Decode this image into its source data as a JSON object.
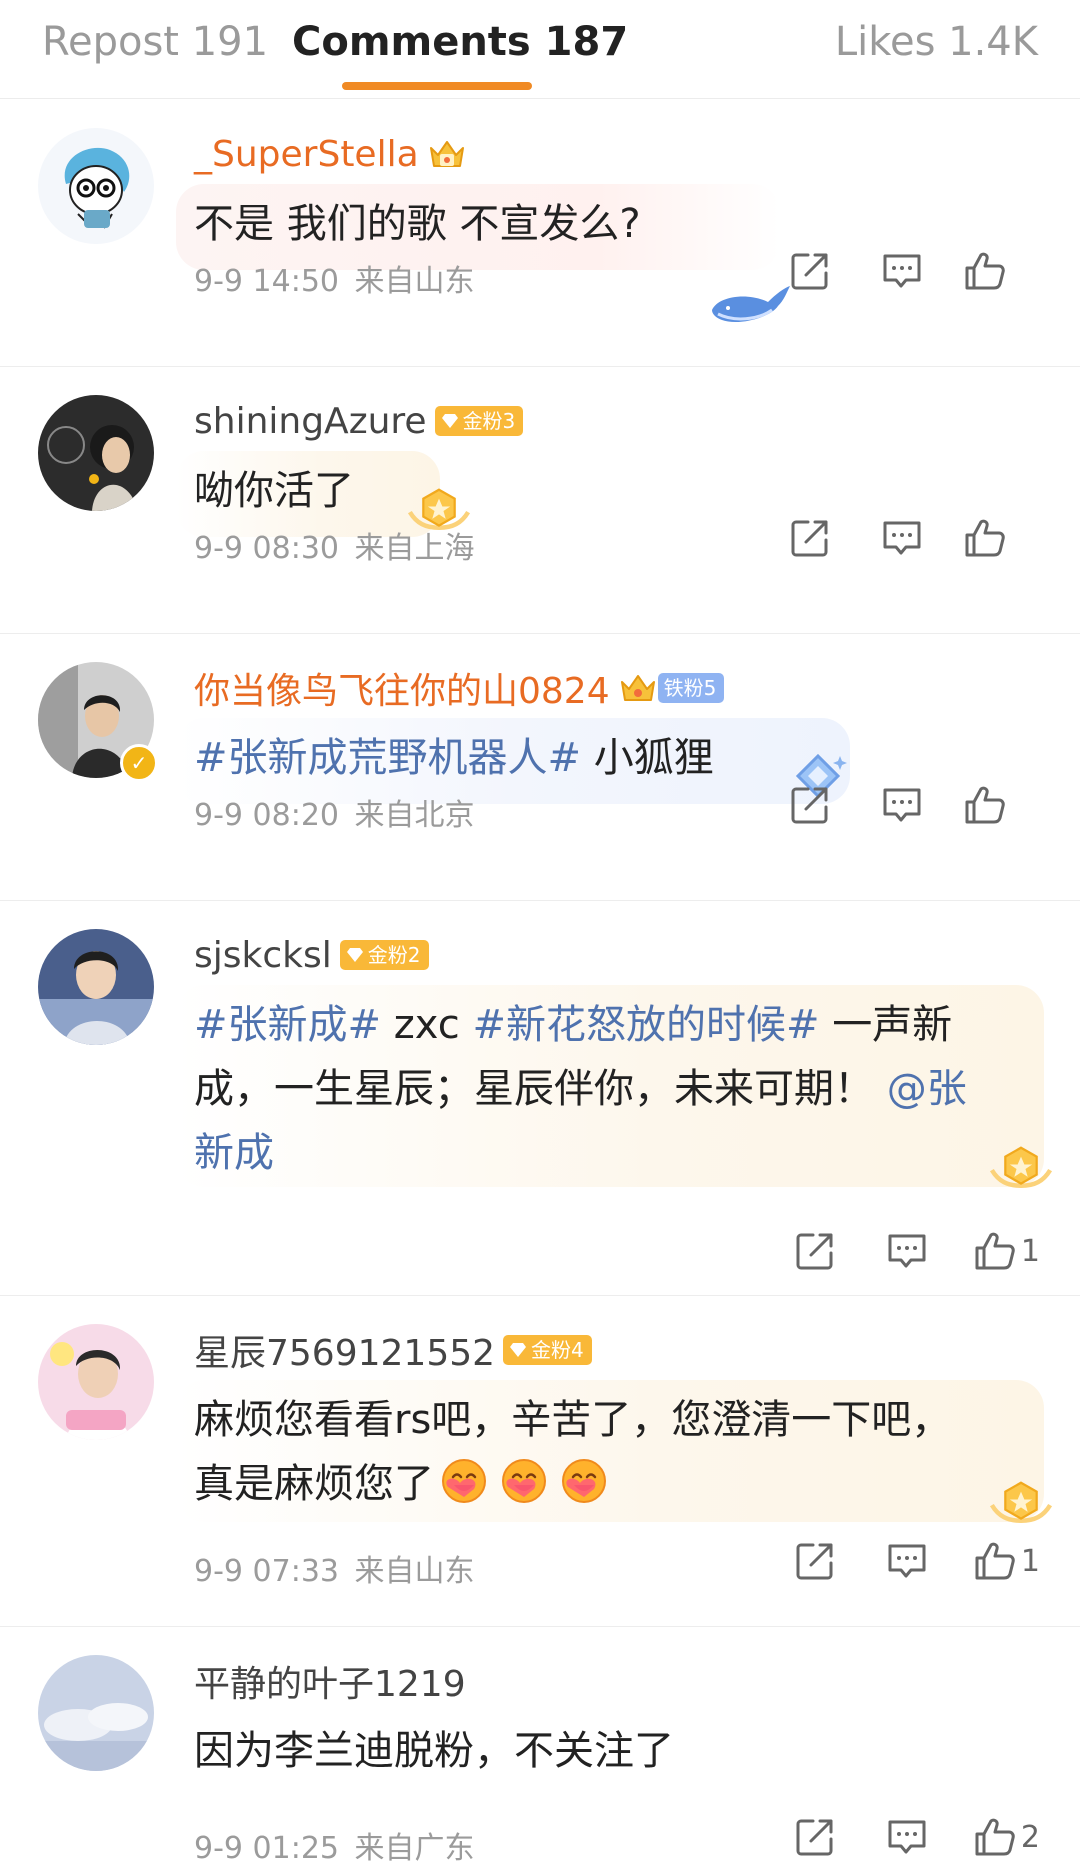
{
  "tabs": {
    "repost": "Repost 191",
    "comments": "Comments 187",
    "likes": "Likes 1.4K"
  },
  "colors": {
    "accent": "#f08a24",
    "hashtag": "#4f72ae",
    "vip_name": "#e86b23",
    "gold_badge": "#f9b838"
  },
  "comments": [
    {
      "username": "_SuperStella",
      "name_style": "vip",
      "badge": null,
      "text": "不是 我们的歌 不宣发么?",
      "time": "9-9 14:50",
      "location": "来自山东",
      "likes": "",
      "icons": [
        "crown-icon",
        "whale-icon"
      ]
    },
    {
      "username": "shiningAzure",
      "badge": "金粉3",
      "text": "呦你活了",
      "time": "9-9 08:30",
      "location": "来自上海",
      "likes": ""
    },
    {
      "username": "你当像鸟飞往你的山0824",
      "name_style": "vip",
      "badge": "铁粉5",
      "hashtag": "#张新成荒野机器人#",
      "text": "小狐狸",
      "time": "9-9 08:20",
      "location": "来自北京",
      "likes": "",
      "verified": true
    },
    {
      "username": "sjskcksl",
      "badge": "金粉2",
      "hashtag1": "#张新成#",
      "text1": "zxc",
      "hashtag2": "#新花怒放的时候#",
      "text2": "一声新成，一生星辰；星辰伴你，未来可期！",
      "mention": "@张新成",
      "likes": "1"
    },
    {
      "username": "星辰7569121552",
      "badge": "金粉4",
      "text": "麻烦您看看rs吧，辛苦了，您澄清一下吧，真是麻烦您了",
      "time": "9-9 07:33",
      "location": "来自山东",
      "likes": "1"
    },
    {
      "username": "平静的叶子1219",
      "badge": null,
      "text": "因为李兰迪脱粉，不关注了",
      "time": "9-9 01:25",
      "location": "来自广东",
      "likes": "2"
    }
  ]
}
